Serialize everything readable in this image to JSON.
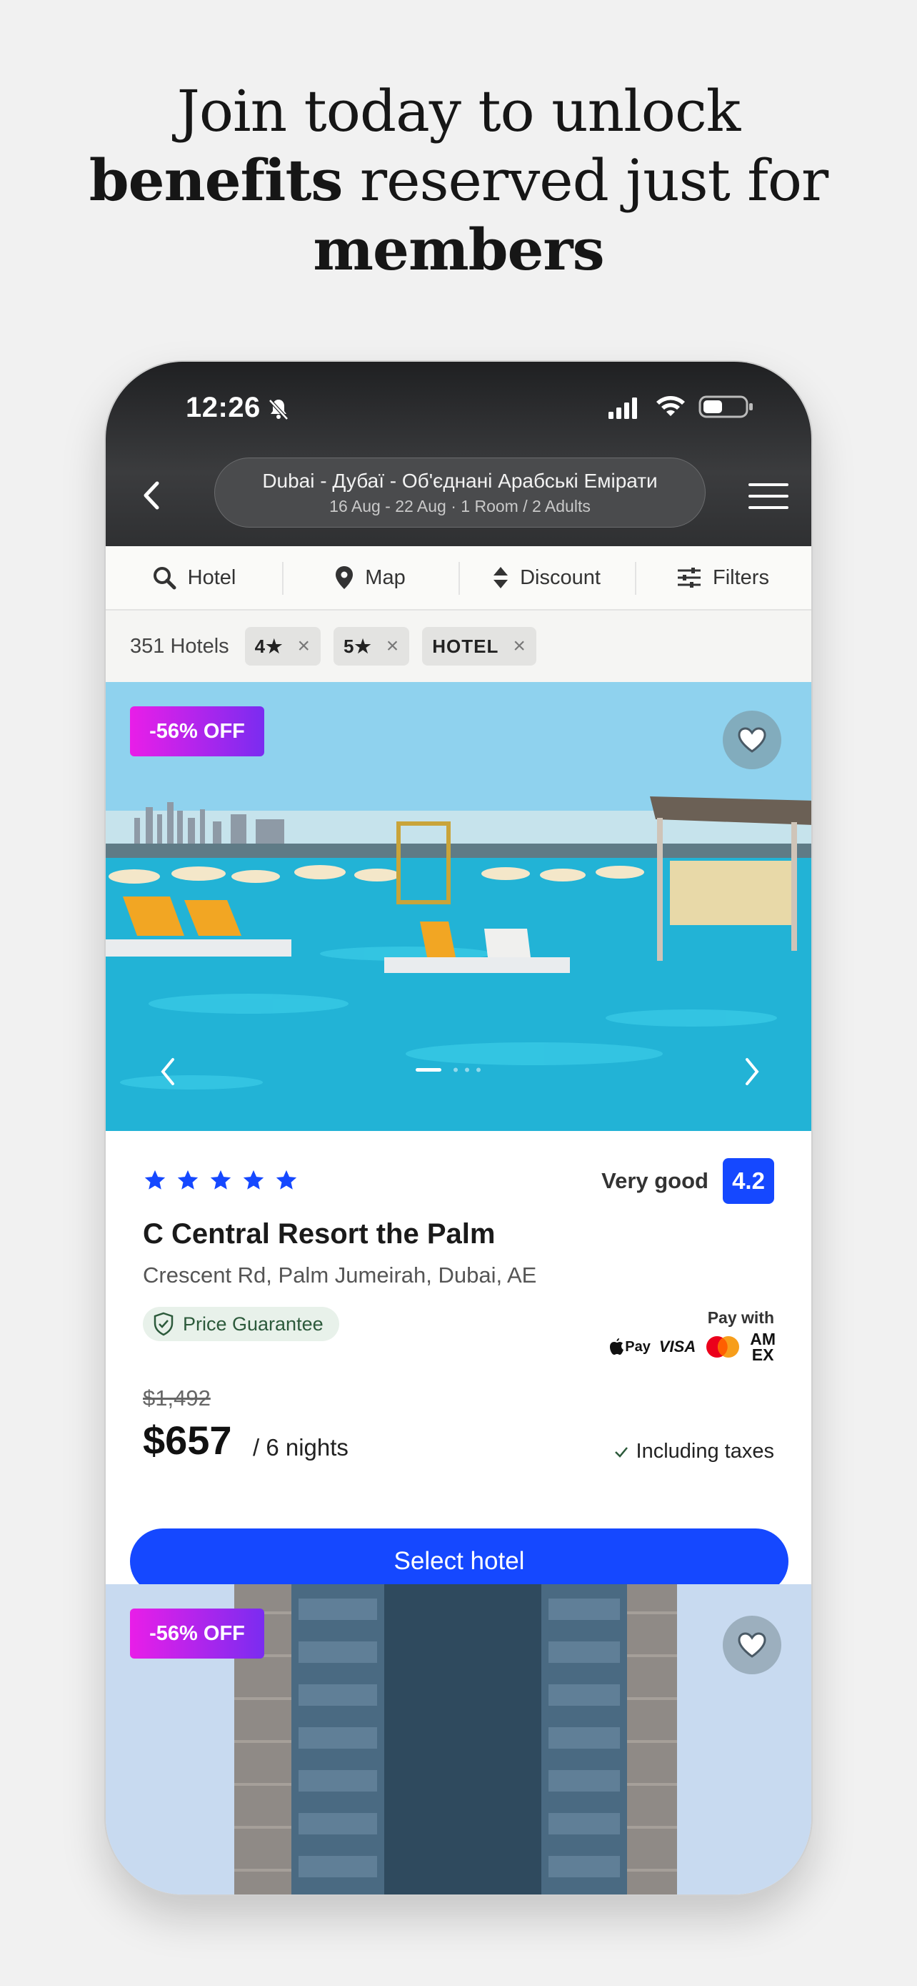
{
  "headline": {
    "line1": "Join today to unlock",
    "bold1": "benefits",
    "line2_rest": " reserved just for",
    "bold2": "members"
  },
  "status_bar": {
    "time": "12:26"
  },
  "search": {
    "destination": "Dubai - Дубаї - Об'єднані Арабські Емірати",
    "details": "16 Aug - 22 Aug  ·  1 Room / 2 Adults"
  },
  "tabs": [
    {
      "label": "Hotel",
      "icon": "search-icon"
    },
    {
      "label": "Map",
      "icon": "map-pin-icon"
    },
    {
      "label": "Discount",
      "icon": "sort-icon"
    },
    {
      "label": "Filters",
      "icon": "sliders-icon"
    }
  ],
  "filters": {
    "count": "351 Hotels",
    "chips": [
      "4★",
      "5★",
      "HOTEL"
    ]
  },
  "hotel": {
    "discount_badge": "-56% OFF",
    "star_rating": 5,
    "rating_text": "Very good",
    "score": "4.2",
    "name": "C Central Resort the Palm",
    "address": "Crescent Rd, Palm Jumeirah, Dubai, AE",
    "guarantee": "Price Guarantee",
    "pay_with": "Pay with",
    "payment_methods": [
      "Pay",
      "VISA",
      "AM",
      "EX"
    ],
    "old_price": "$1,492",
    "price": "$657",
    "nights": "/ 6 nights",
    "taxes": "Including taxes",
    "select_label": "Select hotel"
  },
  "next_hotel": {
    "discount_badge": "-56% OFF"
  },
  "colors": {
    "accent": "#1548ff",
    "badge_start": "#e91ee8",
    "badge_end": "#7a2cf0"
  }
}
